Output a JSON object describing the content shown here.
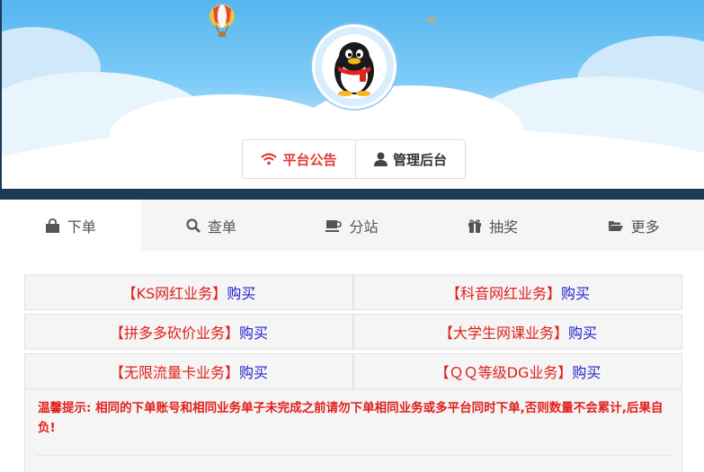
{
  "header": {
    "notice_button": "平台公告",
    "admin_button": "管理后台"
  },
  "tabs": [
    {
      "label": "下单",
      "icon": "shopping-bag-icon"
    },
    {
      "label": "查单",
      "icon": "search-icon"
    },
    {
      "label": "分站",
      "icon": "coffee-cup-icon"
    },
    {
      "label": "抽奖",
      "icon": "gift-icon"
    },
    {
      "label": "更多",
      "icon": "folder-open-icon"
    }
  ],
  "services": [
    {
      "name": "【KS网红业务】",
      "action": "购买"
    },
    {
      "name": "【科音网红业务】",
      "action": "购买"
    },
    {
      "name": "【拼多多砍价业务】",
      "action": "购买"
    },
    {
      "name": "【大学生网课业务】",
      "action": "购买"
    },
    {
      "name": "【无限流量卡业务】",
      "action": "购买"
    },
    {
      "name": "【ＱＱ等级DG业务】",
      "action": "购买"
    }
  ],
  "tip": {
    "text": "温馨提示: 相同的下单账号和相同业务单子未完成之前请勿下单相同业务或多平台同时下单,否则数量不会累计,后果自负!"
  },
  "colors": {
    "accent_red": "#e0201c",
    "link_blue": "#2222cc",
    "sky_blue": "#56b6ef"
  }
}
